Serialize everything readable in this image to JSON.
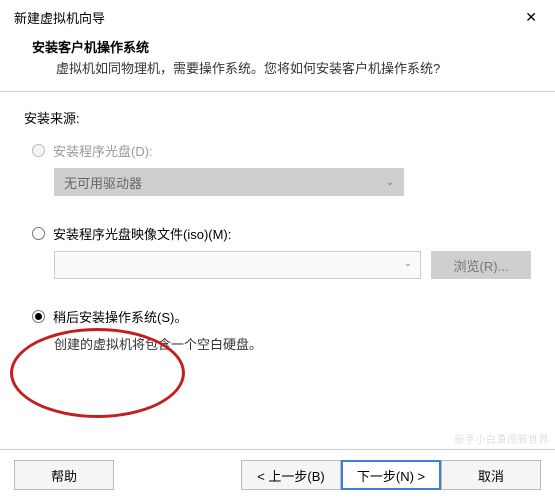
{
  "window": {
    "title": "新建虚拟机向导",
    "close_glyph": "✕"
  },
  "header": {
    "heading": "安装客户机操作系统",
    "sub": "虚拟机如同物理机，需要操作系统。您将如何安装客户机操作系统?"
  },
  "source_label": "安装来源:",
  "options": {
    "disc": {
      "label": "安装程序光盘(D):",
      "select_text": "无可用驱动器",
      "enabled": false
    },
    "iso": {
      "label": "安装程序光盘映像文件(iso)(M):",
      "value": "",
      "browse_label": "浏览(R)..."
    },
    "later": {
      "label": "稍后安装操作系统(S)。",
      "note": "创建的虚拟机将包含一个空白硬盘。",
      "selected": true
    }
  },
  "footer": {
    "help": "帮助",
    "back": "< 上一步(B)",
    "next": "下一步(N) >",
    "cancel": "取消"
  },
  "watermark": "新手小白勇闯新世界"
}
